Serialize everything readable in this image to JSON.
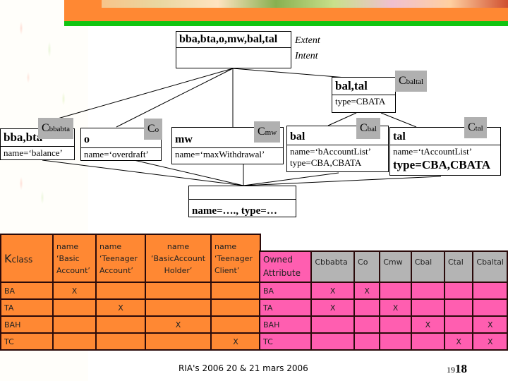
{
  "diagram": {
    "top": {
      "extent": "bba,bta,o,mw,bal,tal",
      "intent": "",
      "extent_label": "Extent",
      "intent_label": "Intent"
    },
    "baltal": {
      "extent": "bal,tal",
      "intent": "type=CBATA",
      "tag": "C",
      "tag_sub": "baltal"
    },
    "bbabta": {
      "extent": "bba,bta",
      "intent": "name=‘balance’",
      "tag": "C",
      "tag_sub": "bbabta"
    },
    "o": {
      "extent": "o",
      "intent": "name=‘overdraft’",
      "tag": "C",
      "tag_sub": "o"
    },
    "mw": {
      "extent": "mw",
      "intent": "name=‘maxWithdrawal’",
      "tag": "C",
      "tag_sub": "mw"
    },
    "bal": {
      "extent": "bal",
      "intent_line1": "name=‘bAccountList’",
      "intent_line2": "type=CBA,CBATA",
      "tag": "C",
      "tag_sub": "bal"
    },
    "tal": {
      "extent": "tal",
      "intent_line1": "name=‘tAccountList’",
      "intent_line2": "type=CBA,CBATA",
      "tag": "C",
      "tag_sub": "tal"
    },
    "bottom": {
      "extent": "",
      "intent": "name=…., type=…"
    }
  },
  "class_table": {
    "corner_big": "K",
    "corner_rest": "class",
    "columns": [
      [
        "name",
        "‘Basic",
        "Account’"
      ],
      [
        "name",
        "‘Teenager",
        "Account’"
      ],
      [
        "name",
        "‘BasicAccount",
        "Holder’"
      ],
      [
        "name",
        "‘Teenager",
        "Client’"
      ]
    ],
    "rows": [
      {
        "label": "BA",
        "cells": [
          "X",
          "",
          "",
          ""
        ]
      },
      {
        "label": "TA",
        "cells": [
          "",
          "X",
          "",
          ""
        ]
      },
      {
        "label": "BAH",
        "cells": [
          "",
          "",
          "X",
          ""
        ]
      },
      {
        "label": "TC",
        "cells": [
          "",
          "",
          "",
          "X"
        ]
      }
    ]
  },
  "attr_table": {
    "corner_line1": "Owned",
    "corner_line2": "Attribute",
    "columns": [
      "Cbbabta",
      "Co",
      "Cmw",
      "Cbal",
      "Ctal",
      "Cbaltal"
    ],
    "rows": [
      {
        "label": "BA",
        "cells": [
          "X",
          "X",
          "",
          "",
          "",
          ""
        ]
      },
      {
        "label": "TA",
        "cells": [
          "X",
          "",
          "X",
          "",
          "",
          ""
        ]
      },
      {
        "label": "BAH",
        "cells": [
          "",
          "",
          "",
          "X",
          "",
          "X"
        ]
      },
      {
        "label": "TC",
        "cells": [
          "",
          "",
          "",
          "",
          "X",
          "X"
        ]
      }
    ]
  },
  "footer": {
    "text": "RIA's 2006 20 & 21 mars 2006",
    "page_small": "19",
    "page_big": "18"
  }
}
